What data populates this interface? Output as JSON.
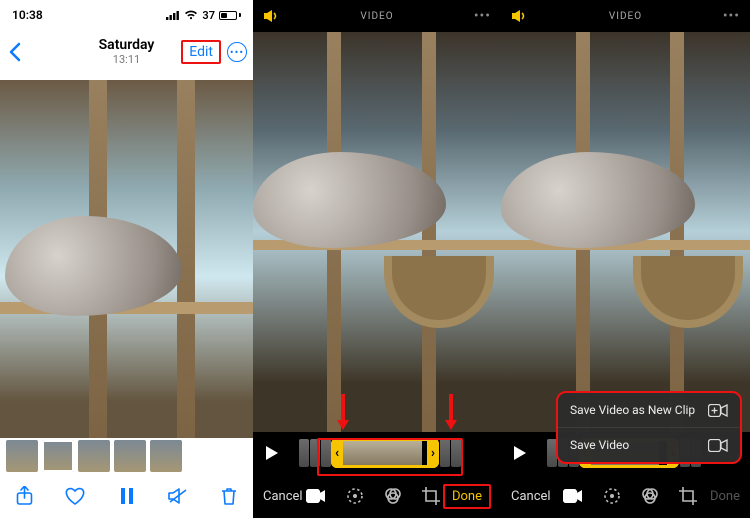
{
  "pane1": {
    "status": {
      "time": "10:38",
      "battery_percent": "37"
    },
    "nav": {
      "day_label": "Saturday",
      "time_label": "13:11",
      "edit_label": "Edit"
    }
  },
  "pane2": {
    "top_label": "VIDEO",
    "cancel_label": "Cancel",
    "done_label": "Done"
  },
  "pane3": {
    "top_label": "VIDEO",
    "cancel_label": "Cancel",
    "done_label": "Done",
    "sheet": {
      "save_new_clip_label": "Save Video as New Clip",
      "save_video_label": "Save Video"
    }
  }
}
